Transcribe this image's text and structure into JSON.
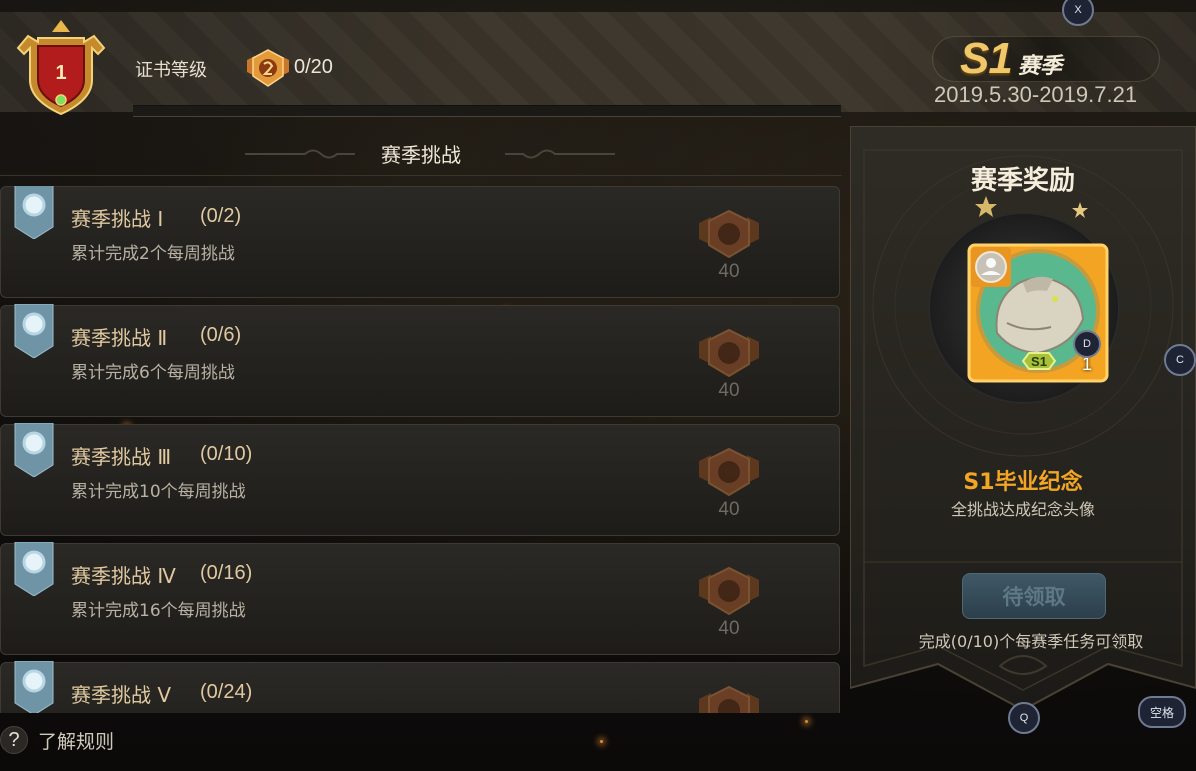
{
  "header": {
    "rank_level": "1",
    "rank_label": "证书等级",
    "coin_count": "0/20",
    "progress_fraction": 0,
    "season_code": "S1",
    "season_word": "赛季",
    "season_dates": "2019.5.30-2019.7.21"
  },
  "challenges": {
    "section_title": "赛季挑战",
    "items": [
      {
        "title": "赛季挑战 Ⅰ",
        "progress": "(0/2)",
        "description": "累计完成2个每周挑战",
        "reward": "40"
      },
      {
        "title": "赛季挑战 Ⅱ",
        "progress": "(0/6)",
        "description": "累计完成6个每周挑战",
        "reward": "40"
      },
      {
        "title": "赛季挑战 Ⅲ",
        "progress": "(0/10)",
        "description": "累计完成10个每周挑战",
        "reward": "40"
      },
      {
        "title": "赛季挑战 Ⅳ",
        "progress": "(0/16)",
        "description": "累计完成16个每周挑战",
        "reward": "40"
      },
      {
        "title": "赛季挑战 Ⅴ",
        "progress": "(0/24)",
        "description": "",
        "reward": ""
      }
    ]
  },
  "reward": {
    "title": "赛季奖励",
    "avatar_badge": "S1",
    "avatar_count": "1",
    "name": "S1毕业纪念",
    "description": "全挑战达成纪念头像",
    "claim_label": "待领取",
    "claim_condition": "完成(0/10)个每赛季任务可领取"
  },
  "footer": {
    "rules_icon": "?",
    "rules_label": "了解规则"
  },
  "key_hints": {
    "x": "X",
    "c": "C",
    "d": "D",
    "q": "Q",
    "space": "空格"
  },
  "colors": {
    "accent_gold": "#f0c86a",
    "reward_orange": "#f3a524",
    "button_disabled": "#2c3f4b"
  }
}
